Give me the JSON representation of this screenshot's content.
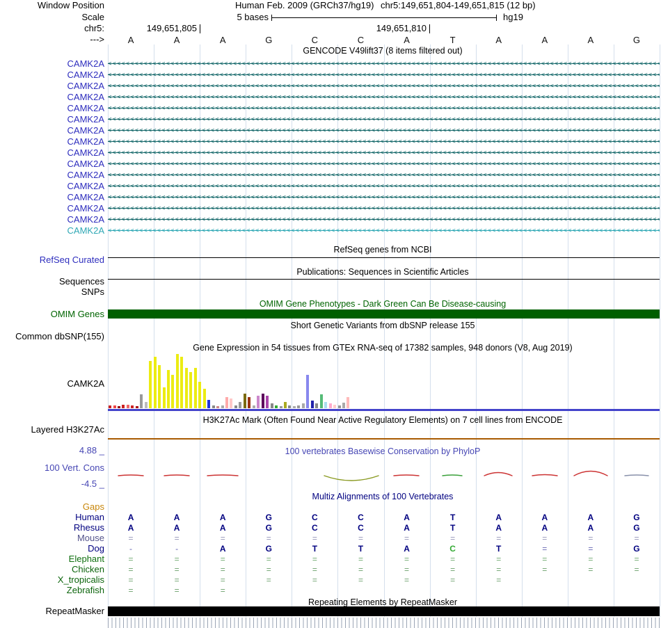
{
  "header": {
    "window_position_label": "Window Position",
    "assembly": "Human Feb. 2009 (GRCh37/hg19)",
    "position": "chr5:149,651,804-149,651,815 (12 bp)",
    "scale_label": "Scale",
    "scale_value": "5 bases",
    "assembly_short": "hg19",
    "chrom_label": "chr5:",
    "strand_arrow": "--->",
    "ruler_ticks": [
      {
        "label": "149,651,805",
        "x": 287
      },
      {
        "label": "149,651,810",
        "x": 617
      }
    ],
    "bases": [
      "A",
      "A",
      "A",
      "G",
      "C",
      "C",
      "A",
      "T",
      "A",
      "A",
      "A",
      "G"
    ]
  },
  "gencode": {
    "title": "GENCODE V49lift37 (8 items filtered out)",
    "transcripts": [
      {
        "label": "CAMK2A",
        "label_color": "#2e2ebe",
        "line_color": "#15686a"
      },
      {
        "label": "CAMK2A",
        "label_color": "#2e2ebe",
        "line_color": "#15686a"
      },
      {
        "label": "CAMK2A",
        "label_color": "#2e2ebe",
        "line_color": "#15686a"
      },
      {
        "label": "CAMK2A",
        "label_color": "#2e2ebe",
        "line_color": "#15686a"
      },
      {
        "label": "CAMK2A",
        "label_color": "#2e2ebe",
        "line_color": "#15686a"
      },
      {
        "label": "CAMK2A",
        "label_color": "#2e2ebe",
        "line_color": "#15686a"
      },
      {
        "label": "CAMK2A",
        "label_color": "#2e2ebe",
        "line_color": "#15686a"
      },
      {
        "label": "CAMK2A",
        "label_color": "#2e2ebe",
        "line_color": "#15686a"
      },
      {
        "label": "CAMK2A",
        "label_color": "#2e2ebe",
        "line_color": "#15686a"
      },
      {
        "label": "CAMK2A",
        "label_color": "#2e2ebe",
        "line_color": "#15686a"
      },
      {
        "label": "CAMK2A",
        "label_color": "#2e2ebe",
        "line_color": "#15686a"
      },
      {
        "label": "CAMK2A",
        "label_color": "#2e2ebe",
        "line_color": "#15686a"
      },
      {
        "label": "CAMK2A",
        "label_color": "#2e2ebe",
        "line_color": "#15686a"
      },
      {
        "label": "CAMK2A",
        "label_color": "#2e2ebe",
        "line_color": "#15686a"
      },
      {
        "label": "CAMK2A",
        "label_color": "#2e2ebe",
        "line_color": "#15686a"
      },
      {
        "label": "CAMK2A",
        "label_color": "#2fa8b5",
        "line_color": "#2fa8b5"
      }
    ]
  },
  "refseq": {
    "title": "RefSeq genes from NCBI",
    "track_label": "RefSeq Curated"
  },
  "publications": {
    "title": "Publications: Sequences in Scientific Articles",
    "track_label": "Sequences"
  },
  "snps": {
    "track_label": "SNPs"
  },
  "omim": {
    "title": "OMIM Gene Phenotypes - Dark Green Can Be Disease-causing",
    "track_label": "OMIM Genes"
  },
  "dbsnp": {
    "title": "Short Genetic Variants from dbSNP release 155",
    "track_label": "Common dbSNP(155)"
  },
  "gtex": {
    "title": "Gene Expression in 54 tissues from GTEx RNA-seq of 17382 samples, 948 donors (V8, Aug 2019)",
    "track_label": "CAMK2A"
  },
  "h3k27ac": {
    "title": "H3K27Ac Mark (Often Found Near Active Regulatory Elements) on 7 cell lines from ENCODE",
    "track_label": "Layered H3K27Ac"
  },
  "phylop": {
    "title": "100 vertebrates Basewise Conservation by PhyloP",
    "track_label": "100 Vert. Cons",
    "max_label": "4.88 _",
    "min_label": "-4.5 _"
  },
  "multiz": {
    "title": "Multiz Alignments of 100 Vertebrates",
    "rows": [
      {
        "label": "Gaps",
        "color": "#c8860a",
        "cells": [
          "",
          "",
          "",
          "",
          "",
          "",
          "",
          "",
          "",
          "",
          "",
          ""
        ]
      },
      {
        "label": "Human",
        "color": "#000080",
        "cells": [
          "A",
          "A",
          "A",
          "G",
          "C",
          "C",
          "A",
          "T",
          "A",
          "A",
          "A",
          "G"
        ]
      },
      {
        "label": "Rhesus",
        "color": "#000080",
        "cells": [
          "A",
          "A",
          "A",
          "G",
          "C",
          "C",
          "A",
          "T",
          "A",
          "A",
          "A",
          "G"
        ]
      },
      {
        "label": "Mouse",
        "color": "#54548c",
        "cells": [
          "=",
          "=",
          "=",
          "=",
          "=",
          "=",
          "=",
          "=",
          "=",
          "=",
          "=",
          "="
        ]
      },
      {
        "label": "Dog",
        "color": "#000080",
        "cells": [
          "-",
          "-",
          "A",
          "G",
          "T",
          "T",
          "A",
          "C",
          "T",
          "=",
          "=",
          "G"
        ],
        "mismatch_index": 7,
        "mismatch_color": "#33aa33"
      },
      {
        "label": "Elephant",
        "color": "#107010",
        "cells": [
          "=",
          "=",
          "=",
          "=",
          "=",
          "=",
          "=",
          "=",
          "=",
          "=",
          "=",
          "="
        ]
      },
      {
        "label": "Chicken",
        "color": "#0c640c",
        "cells": [
          "=",
          "=",
          "=",
          "=",
          "=",
          "=",
          "=",
          "=",
          "=",
          "=",
          "=",
          "="
        ]
      },
      {
        "label": "X_tropicalis",
        "color": "#0c640c",
        "cells": [
          "=",
          "=",
          "=",
          "=",
          "=",
          "=",
          "=",
          "=",
          "=",
          "",
          "",
          ""
        ]
      },
      {
        "label": "Zebrafish",
        "color": "#0c640c",
        "cells": [
          "=",
          "=",
          "=",
          "",
          "",
          "",
          "",
          "",
          "",
          "",
          "",
          ""
        ]
      }
    ]
  },
  "repeatmasker": {
    "title": "Repeating Elements by RepeatMasker",
    "track_label": "RepeatMasker"
  },
  "colors": {
    "omim_bar": "#005f00",
    "repeatmasker_bar": "#000000",
    "gtex_gene_line": "#4343cb",
    "h3k27ac_line": "#a85a00",
    "gencode_line": "#15686a",
    "label_blue": "#2e2ebe",
    "label_teal": "#2fa8b5",
    "phylop_blue": "#4646b4",
    "guideline": "#a0b9d4"
  },
  "chart_data": [
    {
      "type": "bar",
      "title": "Gene Expression in 54 tissues from GTEx RNA-seq of 17382 samples, 948 donors (V8, Aug 2019)",
      "gene": "CAMK2A",
      "note": "54 tissue bars; heights are relative expression in px, tissue names not visible in screenshot",
      "heights": [
        4,
        4,
        3,
        5,
        5,
        4,
        3,
        20,
        9,
        68,
        74,
        62,
        30,
        55,
        48,
        78,
        74,
        58,
        52,
        58,
        38,
        28,
        12,
        4,
        3,
        4,
        16,
        14,
        4,
        9,
        21,
        16,
        4,
        18,
        21,
        18,
        7,
        4,
        3,
        9,
        4,
        3,
        4,
        7,
        48,
        11,
        7,
        20,
        9,
        7,
        5,
        4,
        8,
        16
      ],
      "colors": [
        "#cc2222",
        "#ee4444",
        "#991111",
        "#cc2222",
        "#ee6666",
        "#cc2222",
        "#aa1111",
        "#999999",
        "#bbbbbb",
        "#ecec13",
        "#ecec13",
        "#ecec13",
        "#ecec13",
        "#ecec13",
        "#ecec13",
        "#ecec13",
        "#ecec13",
        "#ecec13",
        "#ecec13",
        "#ecec13",
        "#ecec13",
        "#ecec13",
        "#2233dd",
        "#888888",
        "#cc8888",
        "#aaaaaa",
        "#ffaaaa",
        "#ffc8c8",
        "#888888",
        "#999999",
        "#7a6a10",
        "#993311",
        "#aaaaaa",
        "#cc88cc",
        "#5c005c",
        "#aa44aa",
        "#888888",
        "#33aa33",
        "#999999",
        "#aaaa22",
        "#888888",
        "#aaaaaa",
        "#999999",
        "#aaaaaa",
        "#8888ee",
        "#2222aa",
        "#888888",
        "#55bb77",
        "#aaddee",
        "#ffaacc",
        "#ffcccc",
        "#999999",
        "#aaaaaa",
        "#ffbbbb"
      ]
    },
    {
      "type": "line",
      "title": "100 vertebrates Basewise Conservation by PhyloP",
      "ylim": [
        -4.5,
        4.88
      ],
      "marks": [
        {
          "x": 188,
          "w": 36,
          "amp": -2,
          "color": "#cc3333"
        },
        {
          "x": 254,
          "w": 36,
          "amp": -2,
          "color": "#cc3333"
        },
        {
          "x": 320,
          "w": 44,
          "amp": -2,
          "color": "#cc3333"
        },
        {
          "x": 505,
          "w": 78,
          "amp": 14,
          "color": "#8a9a22"
        },
        {
          "x": 584,
          "w": 36,
          "amp": -2,
          "color": "#cc3333"
        },
        {
          "x": 650,
          "w": 28,
          "amp": -2,
          "color": "#3aa03a"
        },
        {
          "x": 716,
          "w": 40,
          "amp": -9,
          "color": "#cc3333"
        },
        {
          "x": 783,
          "w": 36,
          "amp": -3,
          "color": "#cc3333"
        },
        {
          "x": 849,
          "w": 48,
          "amp": -13,
          "color": "#cc3333"
        },
        {
          "x": 915,
          "w": 34,
          "amp": -2,
          "color": "#8890aa"
        }
      ]
    }
  ]
}
